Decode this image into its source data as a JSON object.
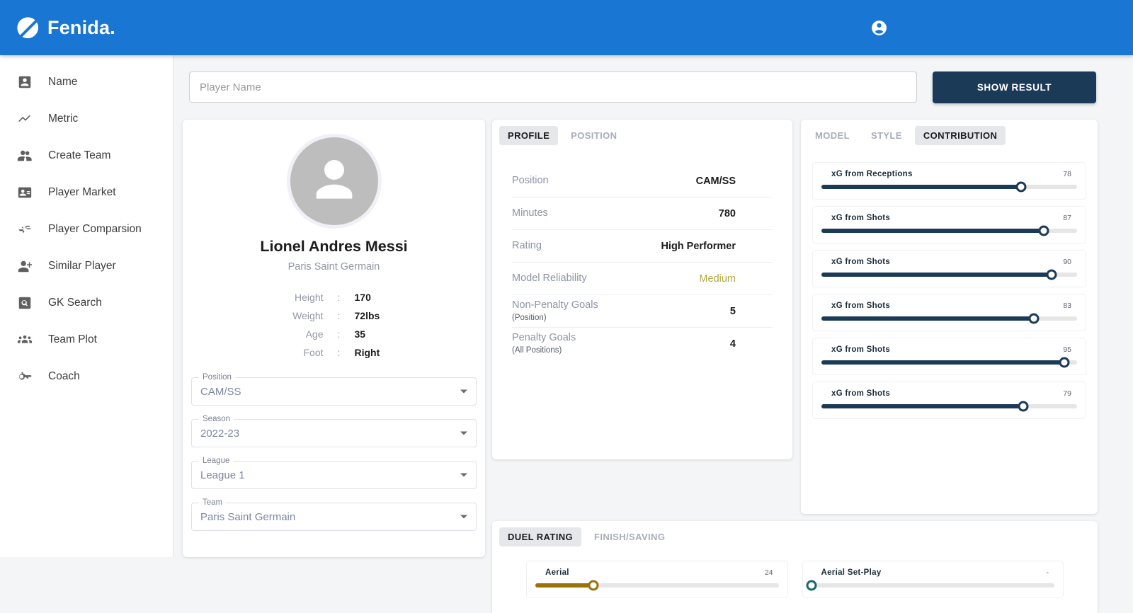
{
  "brand": {
    "name": "Fenida.",
    "logo_icon": "fenida-circle-logo",
    "account_icon": "account-circle-icon",
    "header_color": "#1976d2"
  },
  "sidebar": {
    "items": [
      {
        "label": "Name",
        "icon": "person-badge-icon"
      },
      {
        "label": "Metric",
        "icon": "trend-line-icon"
      },
      {
        "label": "Create Team",
        "icon": "people-icon"
      },
      {
        "label": "Player Market",
        "icon": "person-card-icon"
      },
      {
        "label": "Player Comparsion",
        "icon": "compare-arrows-icon"
      },
      {
        "label": "Similar Player",
        "icon": "person-add-icon"
      },
      {
        "label": "GK Search",
        "icon": "document-search-icon"
      },
      {
        "label": "Team Plot",
        "icon": "group-icon"
      },
      {
        "label": "Coach",
        "icon": "whistle-icon"
      }
    ]
  },
  "search": {
    "placeholder": "Player Name",
    "value": "",
    "button_label": "SHOW RESULT",
    "button_color": "#1b3a57"
  },
  "profile": {
    "avatar_icon": "person-avatar-icon",
    "name": "Lionel Andres Messi",
    "team": "Paris Saint Germain",
    "attributes": [
      {
        "key": "Height",
        "sep": ":",
        "value": "170"
      },
      {
        "key": "Weight",
        "sep": ":",
        "value": "72lbs"
      },
      {
        "key": "Age",
        "sep": ":",
        "value": "35"
      },
      {
        "key": "Foot",
        "sep": ":",
        "value": "Right"
      }
    ],
    "selects": [
      {
        "label": "Position",
        "value": "CAM/SS"
      },
      {
        "label": "Season",
        "value": "2022-23"
      },
      {
        "label": "League",
        "value": "League 1"
      },
      {
        "label": "Team",
        "value": "Paris Saint Germain"
      }
    ]
  },
  "stats_panel": {
    "tabs": [
      {
        "label": "PROFILE",
        "active": true
      },
      {
        "label": "POSITION",
        "active": false
      }
    ],
    "rows": [
      {
        "key": "Position",
        "sub": "",
        "value": "CAM/SS",
        "highlight": false
      },
      {
        "key": "Minutes",
        "sub": "",
        "value": "780",
        "highlight": false
      },
      {
        "key": "Rating",
        "sub": "",
        "value": "High Performer",
        "highlight": false
      },
      {
        "key": "Model Reliability",
        "sub": "",
        "value": "Medium",
        "highlight": true
      },
      {
        "key": "Non-Penalty Goals",
        "sub": "(Position)",
        "value": "5",
        "highlight": false
      },
      {
        "key": "Penalty Goals",
        "sub": "(All Positions)",
        "value": "4",
        "highlight": false
      }
    ],
    "highlight_color": "#b5a642"
  },
  "contribution_panel": {
    "tabs": [
      {
        "label": "MODEL",
        "active": false
      },
      {
        "label": "STYLE",
        "active": false
      },
      {
        "label": "CONTRIBUTION",
        "active": true
      }
    ],
    "sliders": [
      {
        "name": "xG from Receptions",
        "value": "78",
        "pct": 78
      },
      {
        "name": "xG from Shots",
        "value": "87",
        "pct": 87
      },
      {
        "name": "xG from Shots",
        "value": "90",
        "pct": 90
      },
      {
        "name": "xG from Shots",
        "value": "83",
        "pct": 83
      },
      {
        "name": "xG from Shots",
        "value": "95",
        "pct": 95
      },
      {
        "name": "xG from Shots",
        "value": "79",
        "pct": 79
      }
    ],
    "slider_color": "#1b3a57"
  },
  "duel_panel": {
    "tabs": [
      {
        "label": "DUEL RATING",
        "active": true
      },
      {
        "label": "FINISH/SAVING",
        "active": false
      }
    ],
    "sliders": [
      {
        "name": "Aerial",
        "value": "24",
        "pct": 24,
        "color_key": "gold"
      },
      {
        "name": "Aerial Set-Play",
        "value": "-",
        "pct": 0,
        "color_key": "teal"
      }
    ],
    "gold_color": "#9a7209",
    "teal_color": "#17686e"
  }
}
